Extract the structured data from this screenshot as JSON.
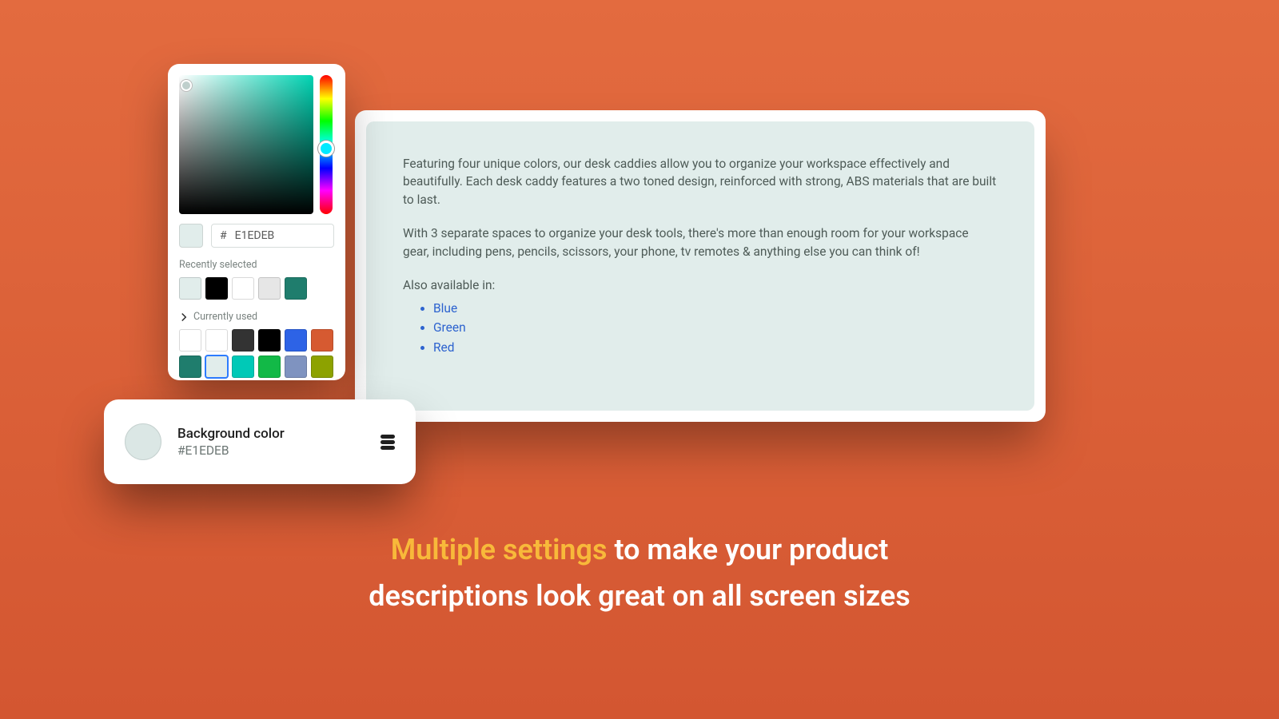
{
  "preview": {
    "p1": "Featuring four unique colors, our desk caddies allow you to organize your workspace effectively and beautifully. Each desk caddy features a two toned design, reinforced with strong, ABS materials that are built to last.",
    "p2": "With 3 separate spaces to organize your desk tools, there's more than enough room for your workspace gear, including pens, pencils, scissors, your phone, tv remotes & anything else you can think of!",
    "also_label": "Also available in:",
    "links": [
      "Blue",
      "Green",
      "Red"
    ]
  },
  "picker": {
    "hex_prefix": "#",
    "hex_value": "E1EDEB",
    "recently_label": "Recently selected",
    "currently_label": "Currently used",
    "recent_swatches": [
      "#e1edeb",
      "#000000",
      "#ffffff",
      "#e6e6e6",
      "#1f7d6d"
    ],
    "used_swatches": [
      "#ffffff",
      "#ffffff",
      "#333333",
      "#000000",
      "#2d63e6",
      "#d65a31",
      "#1f7d6d",
      "#e1edeb",
      "#00c9b7",
      "#12b947",
      "#7f93c0",
      "#8da200"
    ]
  },
  "bgchip": {
    "title": "Background color",
    "value": "#E1EDEB"
  },
  "headline": {
    "accent": "Multiple settings",
    "line1_rest": " to make your product",
    "line2": "descriptions look great on all screen sizes"
  }
}
